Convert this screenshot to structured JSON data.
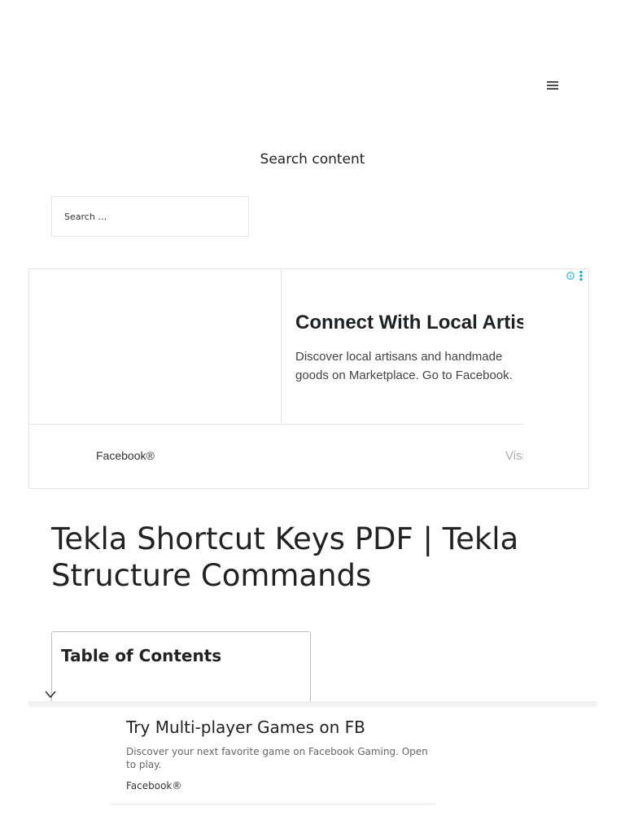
{
  "header": {
    "menu_icon": "hamburger-menu-icon"
  },
  "search": {
    "heading": "Search content",
    "placeholder": "Search …"
  },
  "ad_top": {
    "headline": "Connect With Local Artisans",
    "description": "Discover local artisans and handmade goods on Marketplace. Go to Facebook.",
    "advertiser": "Facebook®",
    "cta": "Visit",
    "info_icon": "ad-info-icon",
    "menu_icon": "ad-options-icon",
    "accent_color": "#00aecd"
  },
  "article": {
    "title": "Tekla Shortcut Keys PDF | Tekla Structure Commands"
  },
  "toc": {
    "title": "Table of Contents",
    "toggle_icon": "chevron-down-icon"
  },
  "anchor_ad": {
    "headline": "Try Multi-player Games on FB",
    "description": "Discover your next favorite game on Facebook Gaming. Open to play.",
    "advertiser": "Facebook®"
  }
}
